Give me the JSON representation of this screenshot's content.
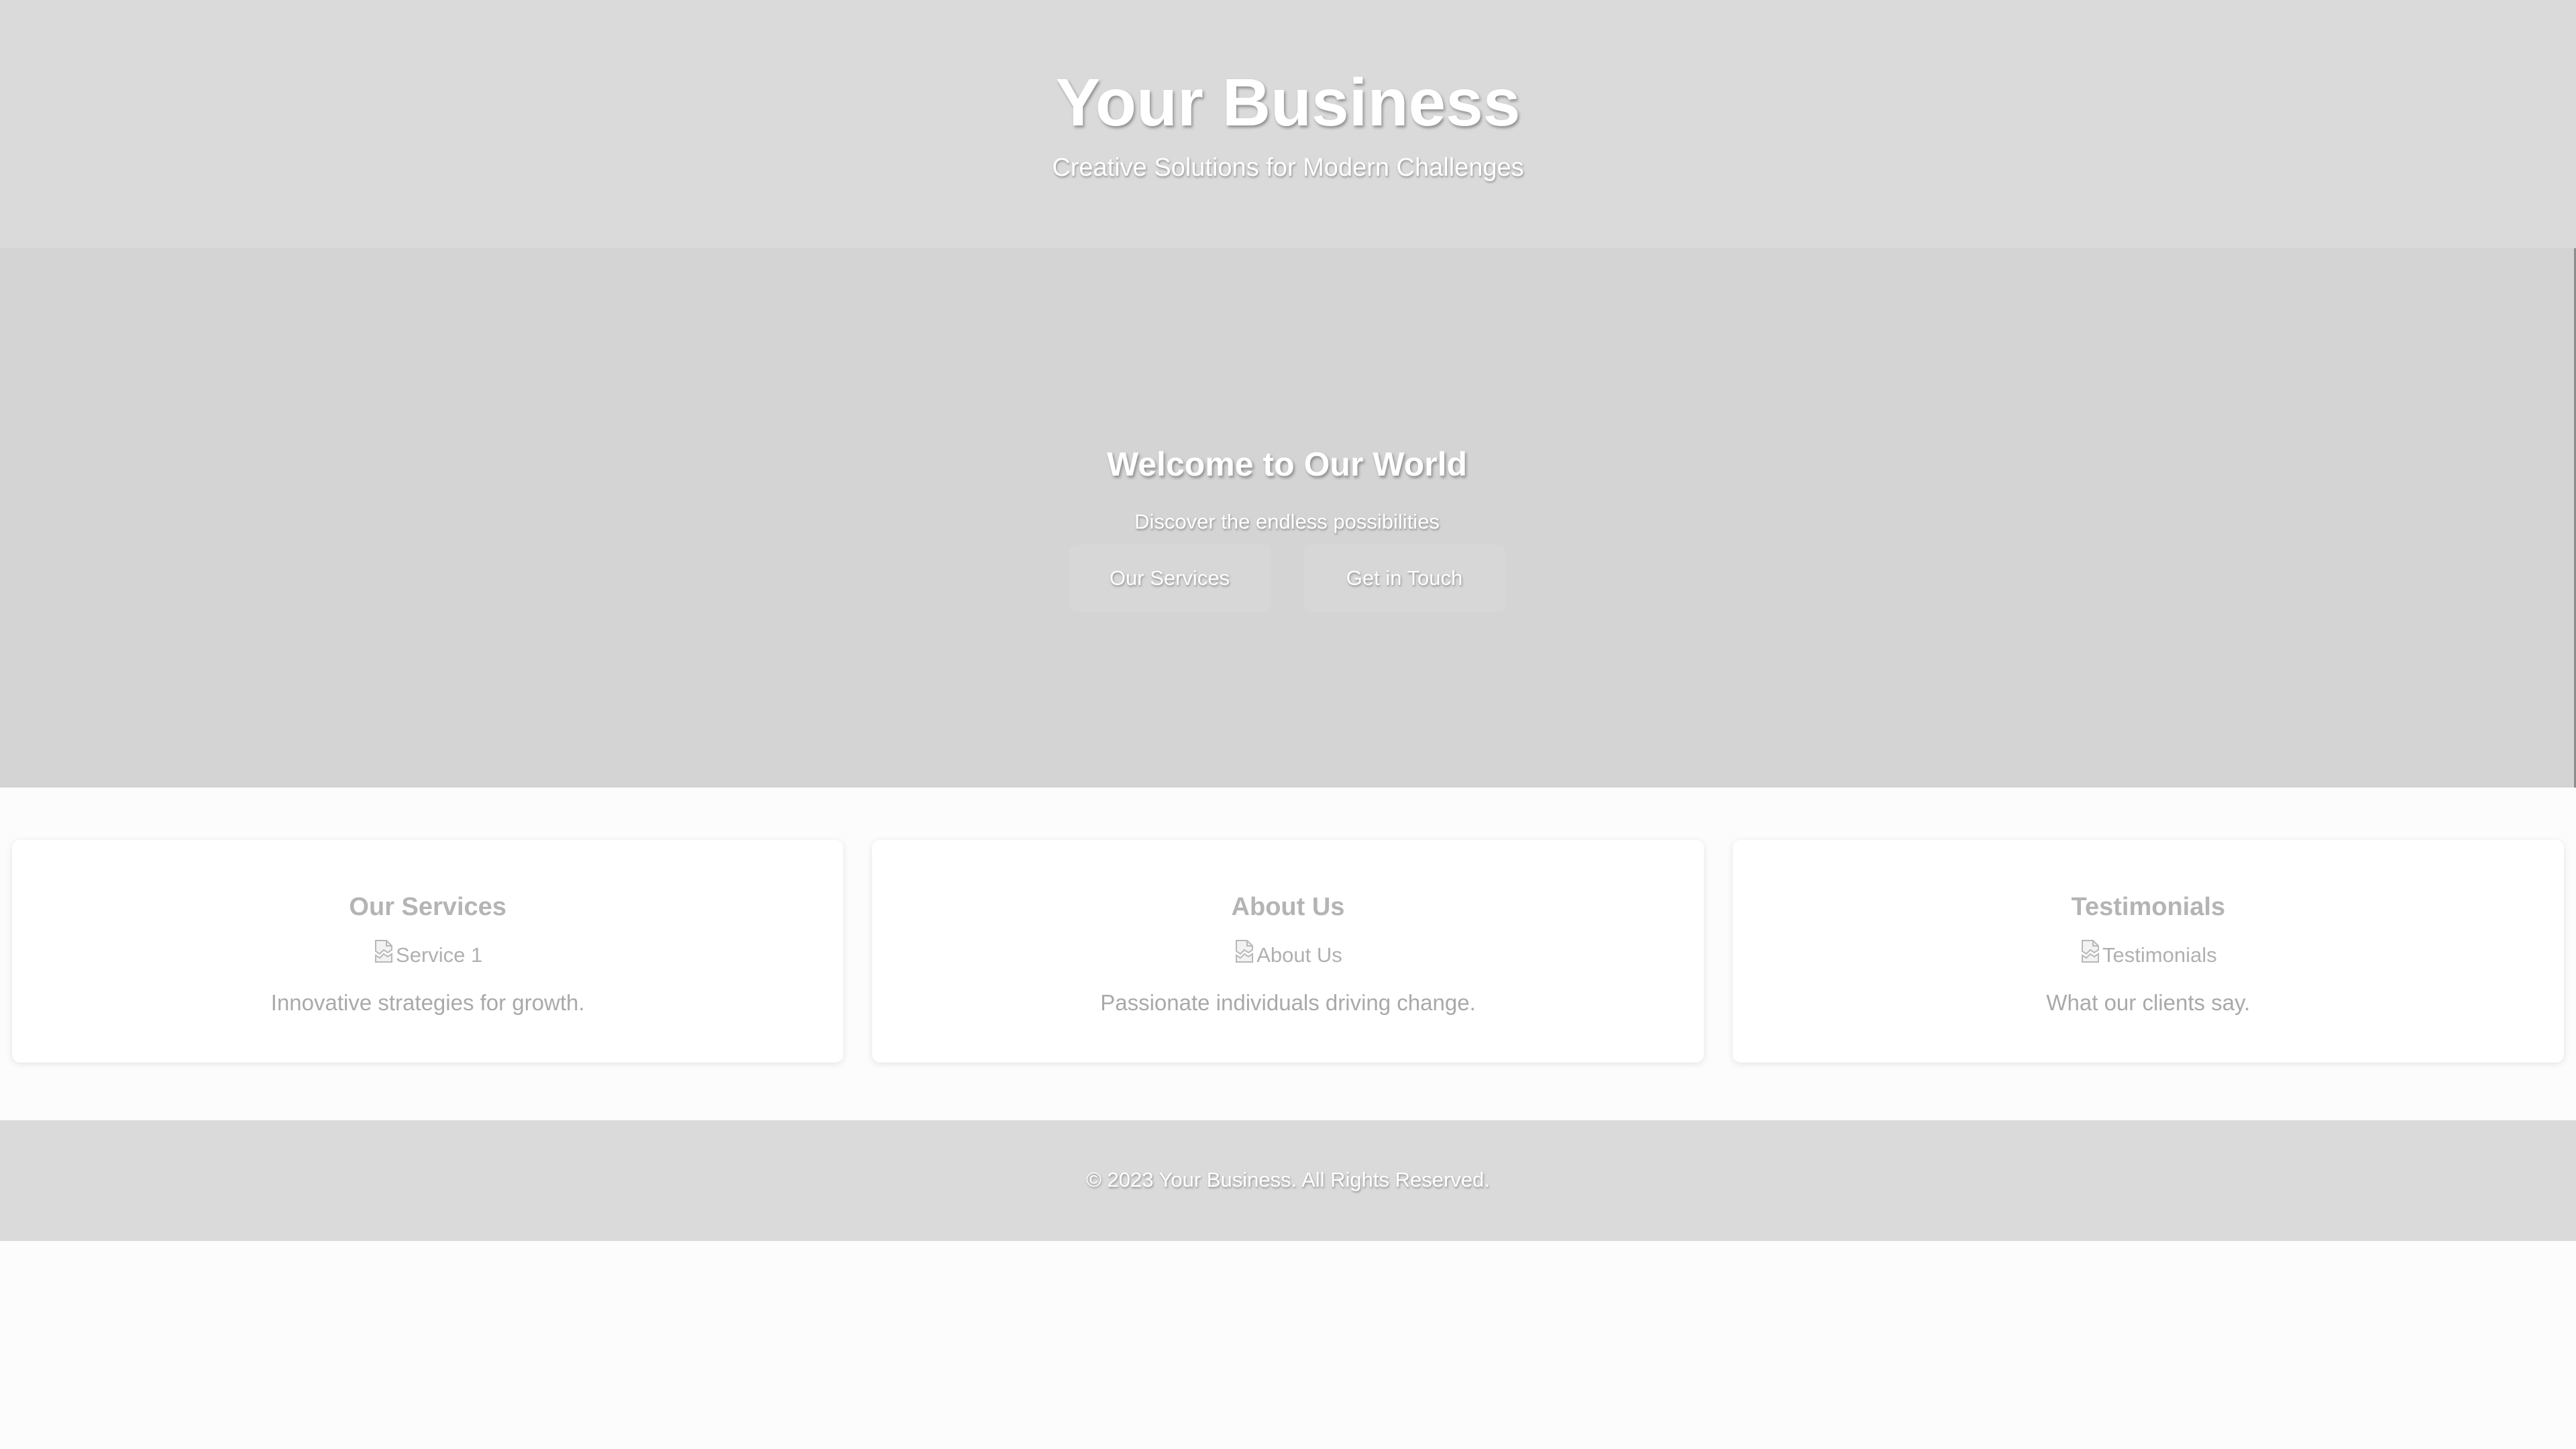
{
  "header": {
    "title": "Your Business",
    "tagline": "Creative Solutions for Modern Challenges"
  },
  "hero": {
    "title": "Welcome to Our World",
    "subtitle": "Discover the endless possibilities",
    "buttons": [
      {
        "label": "Our Services"
      },
      {
        "label": "Get in Touch"
      }
    ]
  },
  "cards": [
    {
      "title": "Our Services",
      "image_alt": "Service 1",
      "text": "Innovative strategies for growth."
    },
    {
      "title": "About Us",
      "image_alt": "About Us",
      "text": "Passionate individuals driving change."
    },
    {
      "title": "Testimonials",
      "image_alt": "Testimonials",
      "text": "What our clients say."
    }
  ],
  "footer": {
    "copyright": "© 2023 Your Business. All Rights Reserved."
  },
  "colors": {
    "header_bg": "#dadada",
    "hero_bg": "#d4d4d4",
    "card_bg": "#ffffff",
    "page_bg": "#fcfcfc",
    "heading_text": "#ffffff",
    "card_title": "#b4b4b4",
    "card_body": "#a9a9a9"
  },
  "icons": {
    "card_image": "broken-image-icon"
  }
}
